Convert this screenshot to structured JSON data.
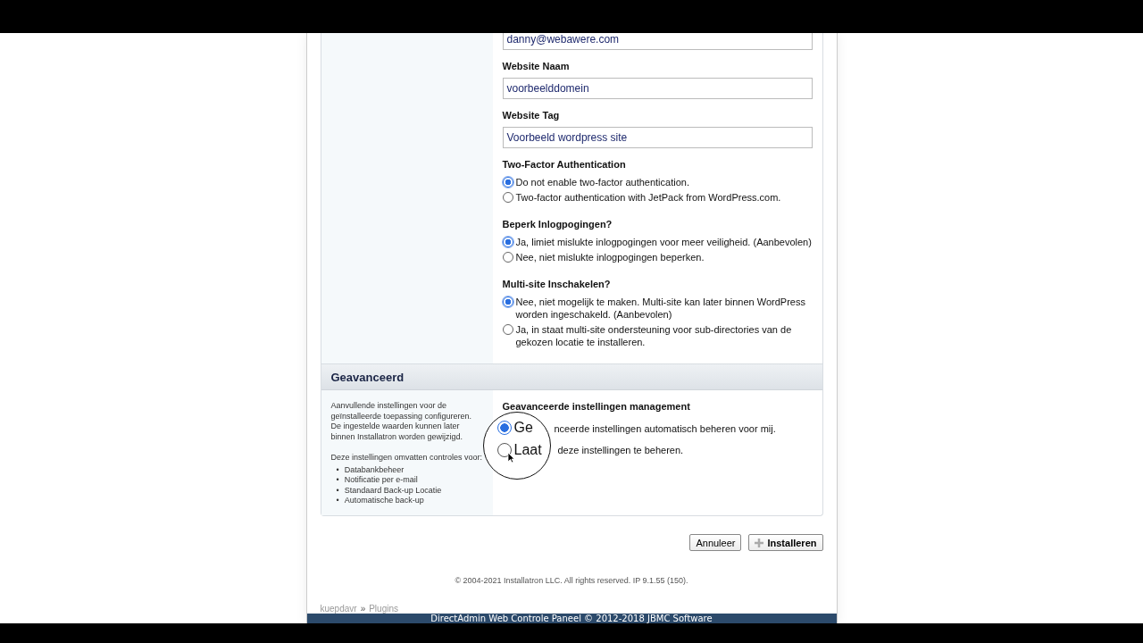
{
  "install_form": {
    "email_value": "danny@webawere.com",
    "fields": [
      {
        "label": "Website Naam",
        "value": "voorbeelddomein"
      },
      {
        "label": "Website Tag",
        "value": "Voorbeeld wordpress site"
      }
    ],
    "radio_groups": [
      {
        "label": "Two-Factor Authentication",
        "options": [
          {
            "label": "Do not enable two-factor authentication.",
            "selected": true
          },
          {
            "label": "Two-factor authentication with JetPack from WordPress.com.",
            "selected": false
          }
        ]
      },
      {
        "label": "Beperk Inlogpogingen?",
        "options": [
          {
            "label": "Ja, limiet mislukte inlogpogingen voor meer veiligheid. (Aanbevolen)",
            "selected": true
          },
          {
            "label": "Nee, niet mislukte inlogpogingen beperken.",
            "selected": false
          }
        ]
      },
      {
        "label": "Multi-site Inschakelen?",
        "options": [
          {
            "label": "Nee, niet mogelijk te maken. Multi-site kan later binnen WordPress worden ingeschakeld. (Aanbevolen)",
            "selected": true
          },
          {
            "label": "Ja, in staat multi-site ondersteuning voor sub-directories van de gekozen locatie te installeren.",
            "selected": false
          }
        ]
      }
    ]
  },
  "advanced": {
    "title": "Geavanceerd",
    "description": "Aanvullende instellingen voor de geïnstalleerde toepassing configureren. De ingestelde waarden kunnen later binnen Installatron worden gewijzigd.",
    "list_intro": "Deze instellingen omvatten controles voor:",
    "list_marker": "•",
    "list": [
      "Databankbeheer",
      "Notificatie per e-mail",
      "Standaard Back-up Locatie",
      "Automatische back-up"
    ],
    "heading": "Geavanceerde instellingen management",
    "options": [
      {
        "label": "nceerde instellingen automatisch beheren voor mij.",
        "lens_text": "Ge",
        "selected": true
      },
      {
        "label": "deze instellingen te beheren.",
        "lens_text": "Laat",
        "selected": false
      }
    ]
  },
  "buttons": [
    {
      "label": "Annuleer",
      "kind": "plain"
    },
    {
      "label": "Installeren",
      "kind": "primary"
    }
  ],
  "copyright": "© 2004-2021 Installatron LLC. All rights reserved. IP 9.1.55 (150).",
  "breadcrumb": {
    "items": [
      "kuepdavr",
      "Plugins"
    ],
    "separator": "»"
  },
  "footer": "DirectAdmin Web Controle Paneel © 2012-2018 JBMC Software"
}
